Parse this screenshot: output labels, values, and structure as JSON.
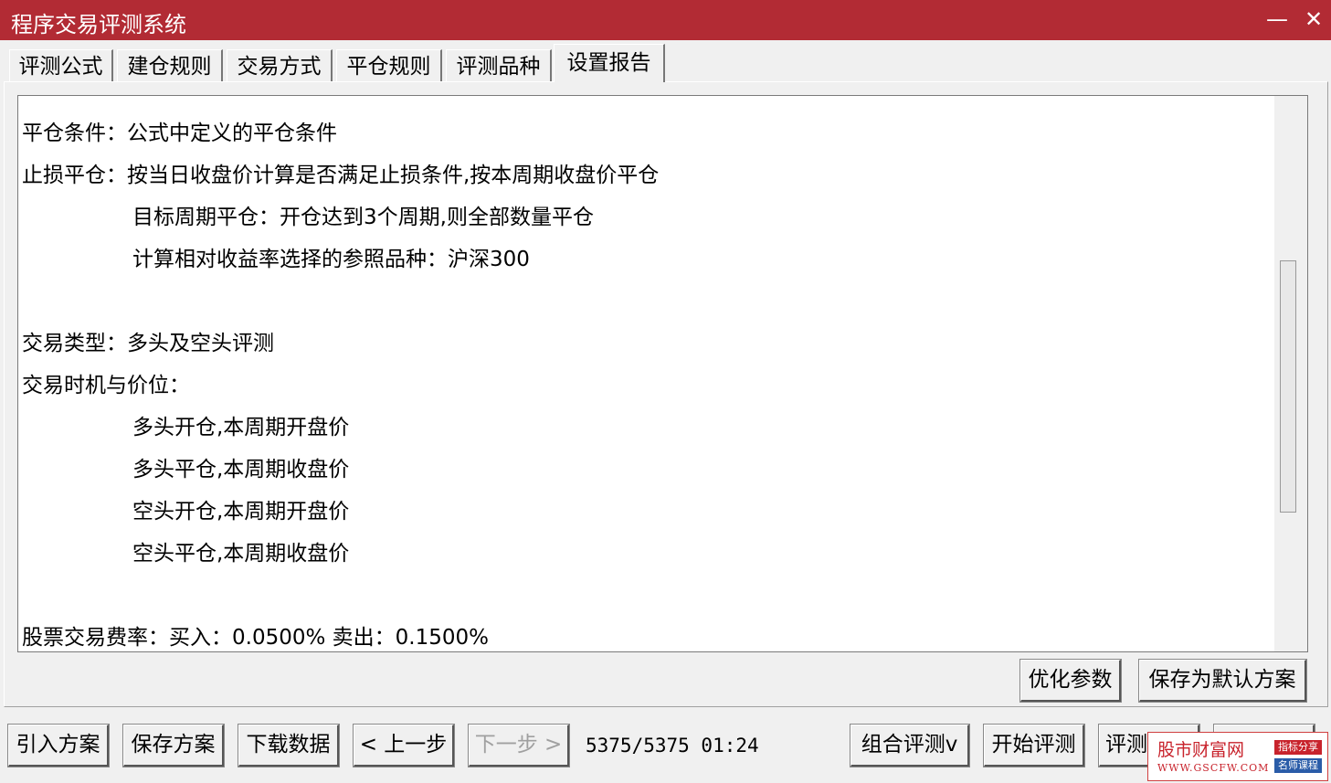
{
  "window": {
    "title": "程序交易评测系统",
    "min_glyph": "—",
    "close_glyph": "✕"
  },
  "tabs": [
    "评测公式",
    "建仓规则",
    "交易方式",
    "平仓规则",
    "评测品种",
    "设置报告"
  ],
  "report": {
    "lines": [
      "平仓条件：公式中定义的平仓条件",
      "止损平仓：按当日收盘价计算是否满足止损条件,按本周期收盘价平仓",
      "目标周期平仓：开仓达到3个周期,则全部数量平仓",
      "计算相对收益率选择的参照品种：沪深300",
      "交易类型：多头及空头评测",
      "交易时机与价位：",
      "多头开仓,本周期开盘价",
      "多头平仓,本周期收盘价",
      "空头开仓,本周期开盘价",
      "空头平仓,本周期收盘价",
      "股票交易费率：买入：0.0500%  卖出：0.1500%"
    ]
  },
  "panel_buttons": {
    "optimize": "优化参数",
    "save_default": "保存为默认方案"
  },
  "bottom_buttons": {
    "import": "引入方案",
    "save": "保存方案",
    "download": "下载数据",
    "prev": "<  上一步",
    "next": "下一步  >",
    "combo": "组合评测v",
    "start": "开始评测",
    "eval": "评测"
  },
  "status": "5375/5375  01:24",
  "watermark": {
    "cn": "股市财富网",
    "en": "WWW.GSCFW.COM",
    "tag1": "指标分享",
    "tag2": "名师课程"
  },
  "colors": {
    "titlebar": "#b22b34",
    "watermark": "#c8232c"
  }
}
